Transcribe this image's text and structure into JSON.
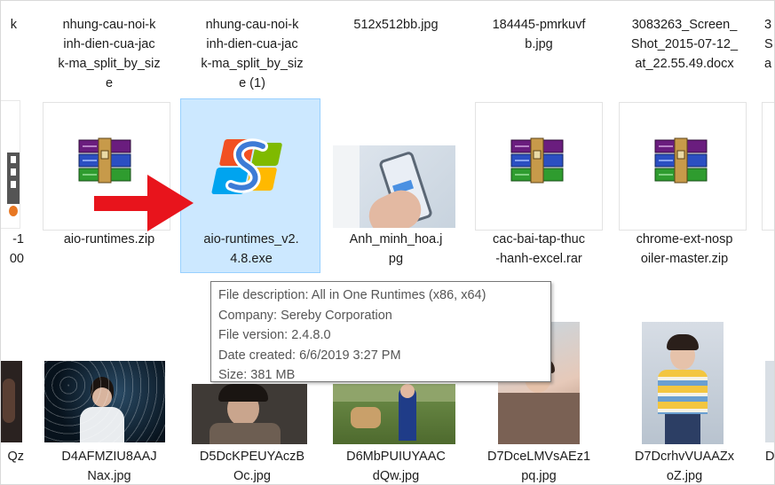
{
  "files": {
    "row1": [
      {
        "name": "k",
        "partial": true
      },
      {
        "name": "nhung-cau-noi-k\ninh-dien-cua-jac\nk-ma_split_by_siz\ne"
      },
      {
        "name": "nhung-cau-noi-k\ninh-dien-cua-jac\nk-ma_split_by_siz\ne (1)"
      },
      {
        "name": "512x512bb.jpg"
      },
      {
        "name": "184445-pmrkuvf\nb.jpg"
      },
      {
        "name": "3083263_Screen_\nShot_2015-07-12_\nat_22.55.49.docx"
      },
      {
        "name": "3\nS\na",
        "partial": true
      }
    ],
    "row2": [
      {
        "name": "-1\n00",
        "partial": true
      },
      {
        "name": "aio-runtimes.zip",
        "icon": "winrar-archive-icon"
      },
      {
        "name": "aio-runtimes_v2.\n4.8.exe",
        "icon": "aio-runtimes-app-icon",
        "selected": true
      },
      {
        "name": "Anh_minh_hoa.j\npg",
        "icon": "phone-photo-thumbnail"
      },
      {
        "name": "cac-bai-tap-thuc\n-hanh-excel.rar",
        "icon": "winrar-archive-icon"
      },
      {
        "name": "chrome-ext-nosp\noiler-master.zip",
        "icon": "winrar-archive-icon"
      }
    ],
    "row3": [
      {
        "name": "Qz",
        "partial": true
      },
      {
        "name": "D4AFMZIU8AAJ\nNax.jpg"
      },
      {
        "name": "D5DcKPEUYAczB\nOc.jpg"
      },
      {
        "name": "D6MbPUIUYAAC\ndQw.jpg"
      },
      {
        "name": "D7DceLMVsAEz1\npq.jpg"
      },
      {
        "name": "D7DcrhvVUAAZx\noZ.jpg"
      }
    ]
  },
  "tooltip": {
    "description": "File description: All in One Runtimes (x86, x64)",
    "company": "Company: Sereby Corporation",
    "version": "File version: 2.4.8.0",
    "created": "Date created: 6/6/2019 3:27 PM",
    "size": "Size: 381 MB"
  },
  "colors": {
    "selection_bg": "#cce8ff",
    "selection_border": "#99d1ff",
    "arrow": "#e8141c"
  }
}
